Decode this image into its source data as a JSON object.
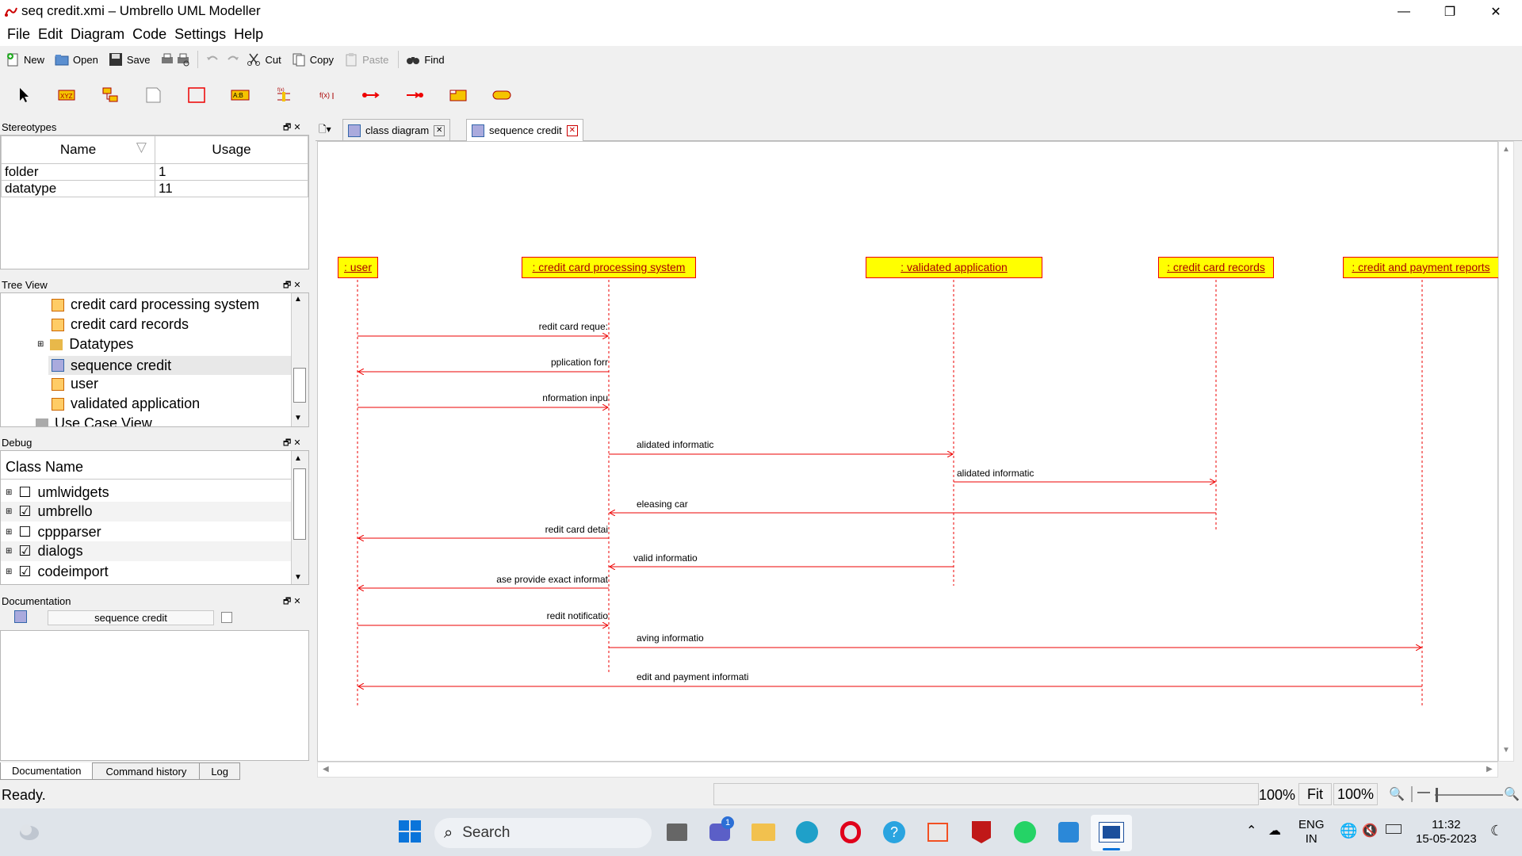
{
  "window": {
    "title": "seq credit.xmi – Umbrello UML Modeller"
  },
  "menu": [
    "File",
    "Edit",
    "Diagram",
    "Code",
    "Settings",
    "Help"
  ],
  "toolbar": {
    "new": "New",
    "open": "Open",
    "save": "Save",
    "cut": "Cut",
    "copy": "Copy",
    "paste": "Paste",
    "find": "Find"
  },
  "stereotypes": {
    "title": "Stereotypes",
    "columns": [
      "Name",
      "Usage"
    ],
    "rows": [
      [
        "folder",
        "1"
      ],
      [
        "datatype",
        "11"
      ]
    ]
  },
  "tree": {
    "title": "Tree View",
    "items": [
      "credit card processing system",
      "credit card records",
      "Datatypes",
      "sequence credit",
      "user",
      "validated application",
      "Use Case View"
    ]
  },
  "debug": {
    "title": "Debug",
    "column": "Class Name",
    "items": [
      {
        "name": "umlwidgets",
        "checked": "☐"
      },
      {
        "name": "umbrello",
        "checked": "☑"
      },
      {
        "name": "cppparser",
        "checked": "☐"
      },
      {
        "name": "dialogs",
        "checked": "☑"
      },
      {
        "name": "codeimport",
        "checked": "☑"
      }
    ]
  },
  "documentation": {
    "title": "Documentation",
    "doc_name": "sequence credit",
    "tabs": [
      "Documentation",
      "Command history",
      "Log"
    ]
  },
  "tabs": [
    "class diagram",
    "sequence credit"
  ],
  "diagram": {
    "objects": [
      ": user",
      ": credit card processing system",
      ": validated application",
      ": credit card records",
      ": credit and payment reports"
    ],
    "messages": [
      "redit card reque:",
      "pplication forr",
      "nformation inpu",
      "alidated informatic",
      "alidated informatic",
      "eleasing car",
      "redit card detai",
      "valid informatio",
      "ase provide exact informat",
      "redit notificatio",
      "aving informatio",
      "edit and payment informati"
    ]
  },
  "status": {
    "text": "Ready.",
    "zoom1": "100%",
    "fit": "Fit",
    "zoom2": "100%"
  },
  "taskbar": {
    "search": "Search",
    "lang1": "ENG",
    "lang2": "IN",
    "time": "11:32",
    "date": "15-05-2023",
    "teams_badge": "1"
  }
}
